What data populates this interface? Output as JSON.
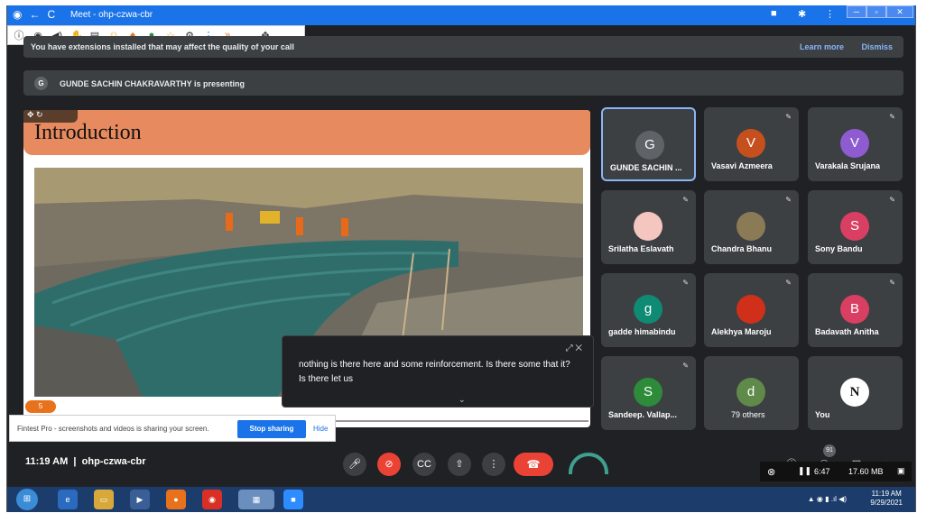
{
  "browser": {
    "tab_title": "Meet - ohp-czwa-cbr"
  },
  "banner": {
    "message": "You have extensions installed that may affect the quality of your call",
    "learn_more": "Learn more",
    "dismiss": "Dismiss"
  },
  "presenter": {
    "initial": "G",
    "text": "GUNDE SACHIN CHAKRAVARTHY is presenting"
  },
  "slide": {
    "title": "Introduction",
    "page_number": "5"
  },
  "share_bar": {
    "text": "Fintest Pro - screenshots and videos is sharing your screen.",
    "stop": "Stop sharing",
    "hide": "Hide"
  },
  "caption": {
    "text": "nothing is there here and some reinforcement. Is there some that it? Is there let us"
  },
  "participants": [
    {
      "name": "GUNDE SACHIN ...",
      "initial": "G",
      "color": "#5f6368"
    },
    {
      "name": "Vasavi Azmeera",
      "initial": "V",
      "color": "#c5501d"
    },
    {
      "name": "Varakala Srujana",
      "initial": "V",
      "color": "#8e5bd1"
    },
    {
      "name": "Srilatha Eslavath",
      "initial": "",
      "color": "#f5c6c0"
    },
    {
      "name": "Chandra Bhanu",
      "initial": "",
      "color": "#8a7a55"
    },
    {
      "name": "Sony Bandu",
      "initial": "S",
      "color": "#d93f62"
    },
    {
      "name": "gadde himabindu",
      "initial": "g",
      "color": "#0f8a73"
    },
    {
      "name": "Alekhya Maroju",
      "initial": "",
      "color": "#d0301a"
    },
    {
      "name": "Badavath Anitha",
      "initial": "B",
      "color": "#d93f62"
    },
    {
      "name": "Sandeep. Vallap...",
      "initial": "S",
      "color": "#2e8b3a"
    },
    {
      "name": "79 others",
      "initial": "d",
      "color": "#5f8a4a"
    },
    {
      "name": "You",
      "initial": "N",
      "color": "#ffffff"
    }
  ],
  "meeting": {
    "time": "11:19 AM",
    "code": "ohp-czwa-cbr",
    "separator": "|",
    "people_count": "91"
  },
  "recorder": {
    "elapsed": "6:47",
    "size": "17.60 MB"
  },
  "taskbar": {
    "time": "11:19 AM",
    "date": "9/29/2021"
  }
}
